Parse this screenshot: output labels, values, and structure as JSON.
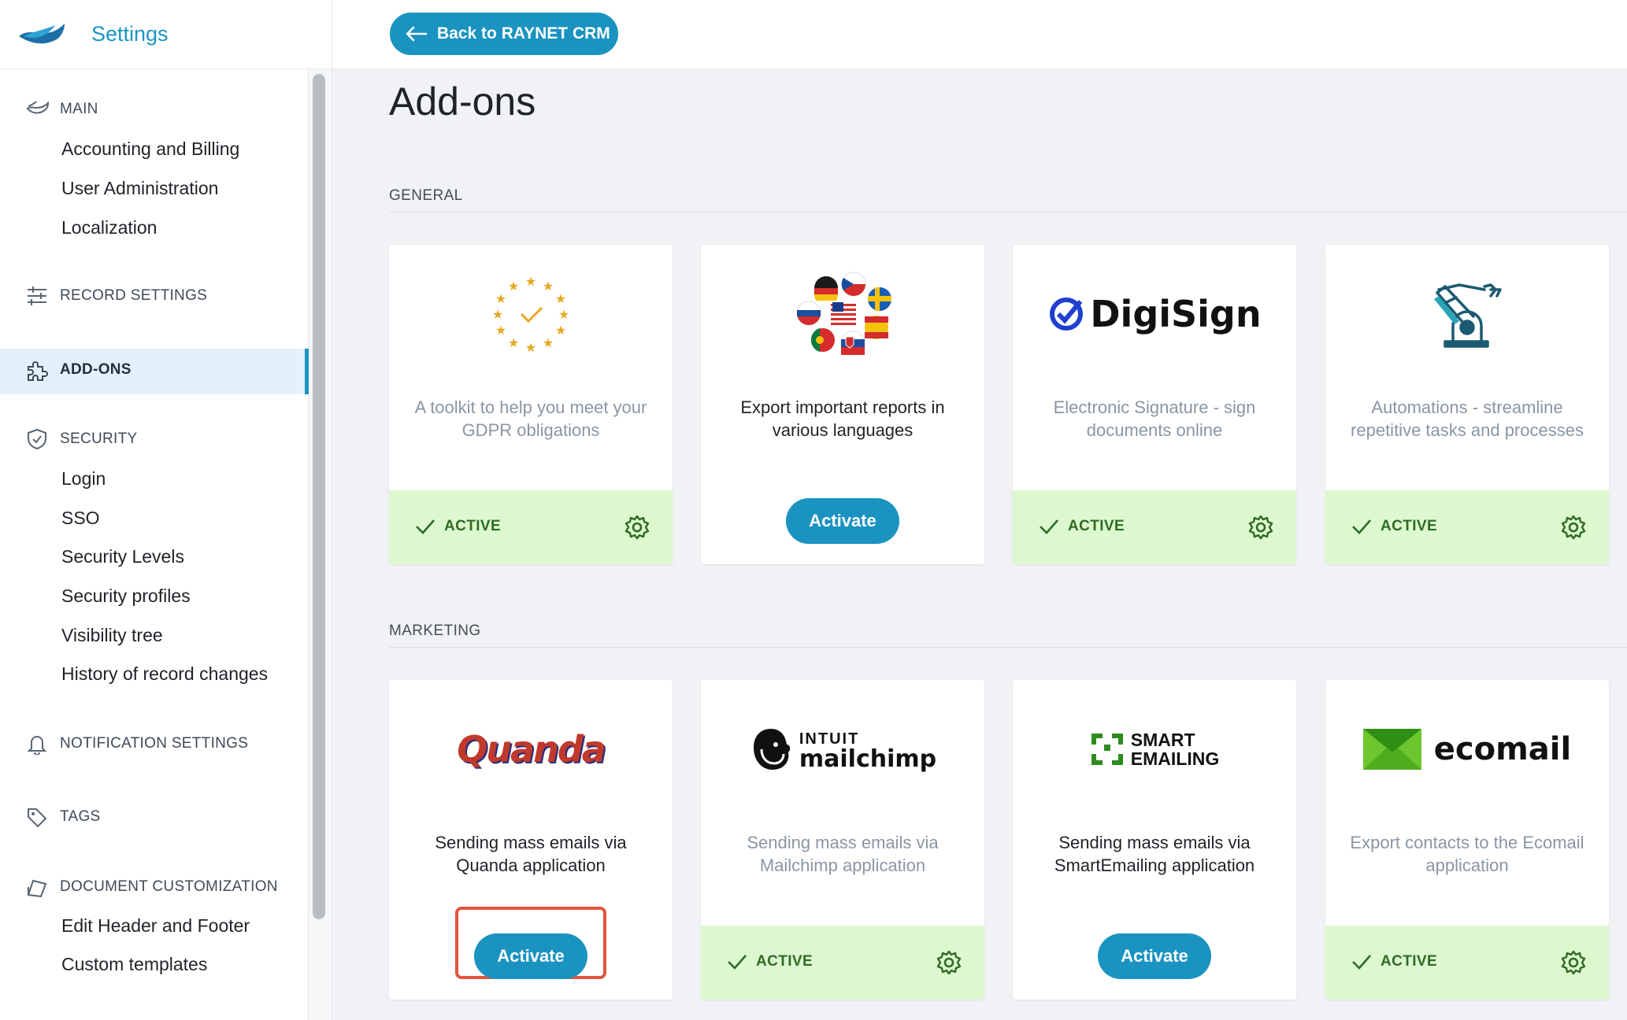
{
  "sidebar": {
    "title": "Settings",
    "sections": [
      {
        "label": "MAIN",
        "icon": "raynet-fish-icon",
        "items": [
          "Accounting and Billing",
          "User Administration",
          "Localization"
        ]
      },
      {
        "label": "RECORD SETTINGS",
        "icon": "sliders-icon",
        "items": []
      },
      {
        "label": "ADD-ONS",
        "icon": "puzzle-icon",
        "items": [],
        "selected": true
      },
      {
        "label": "SECURITY",
        "icon": "shield-icon",
        "items": [
          "Login",
          "SSO",
          "Security Levels",
          "Security profiles",
          "Visibility tree",
          "History of record changes"
        ]
      },
      {
        "label": "NOTIFICATION SETTINGS",
        "icon": "bell-icon",
        "items": []
      },
      {
        "label": "TAGS",
        "icon": "tag-icon",
        "items": []
      },
      {
        "label": "DOCUMENT CUSTOMIZATION",
        "icon": "document-icon",
        "items": [
          "Edit Header and Footer",
          "Custom templates"
        ]
      }
    ]
  },
  "topbar": {
    "back_label": "Back to RAYNET CRM"
  },
  "page": {
    "title": "Add-ons"
  },
  "groups": [
    {
      "label": "GENERAL",
      "cards": [
        {
          "name": "gdpr",
          "logo": "eu-stars-check-icon",
          "description": "A toolkit to help you meet your GDPR obligations",
          "active": true
        },
        {
          "name": "languages",
          "logo": "flags-icon",
          "description": "Export important reports in various languages",
          "active": false
        },
        {
          "name": "digisign",
          "logo_text": "DigiSign",
          "description": "Electronic Signature - sign documents online",
          "active": true
        },
        {
          "name": "automations",
          "logo": "robot-arm-icon",
          "description": "Automations - streamline repetitive tasks and processes",
          "active": true
        }
      ]
    },
    {
      "label": "MARKETING",
      "cards": [
        {
          "name": "quanda",
          "logo_text": "Quanda",
          "description": "Sending mass emails via Quanda application",
          "active": false,
          "highlighted": true
        },
        {
          "name": "mailchimp",
          "logo_text_top": "INTUIT",
          "logo_text": "mailchimp",
          "description": "Sending mass emails via Mailchimp application",
          "active": true
        },
        {
          "name": "smartemailing",
          "logo_text_top": "SMART",
          "logo_text": "EMAILING",
          "description": "Sending mass emails via SmartEmailing application",
          "active": false
        },
        {
          "name": "ecomail",
          "logo_text": "ecomail",
          "description": "Export contacts to the Ecomail application",
          "active": true
        }
      ]
    }
  ],
  "labels": {
    "active": "ACTIVE",
    "activate": "Activate"
  },
  "colors": {
    "accent": "#1a93c0",
    "active_bg": "#ddf8cf",
    "active_text": "#2e6b25",
    "highlight": "#e3553f"
  }
}
